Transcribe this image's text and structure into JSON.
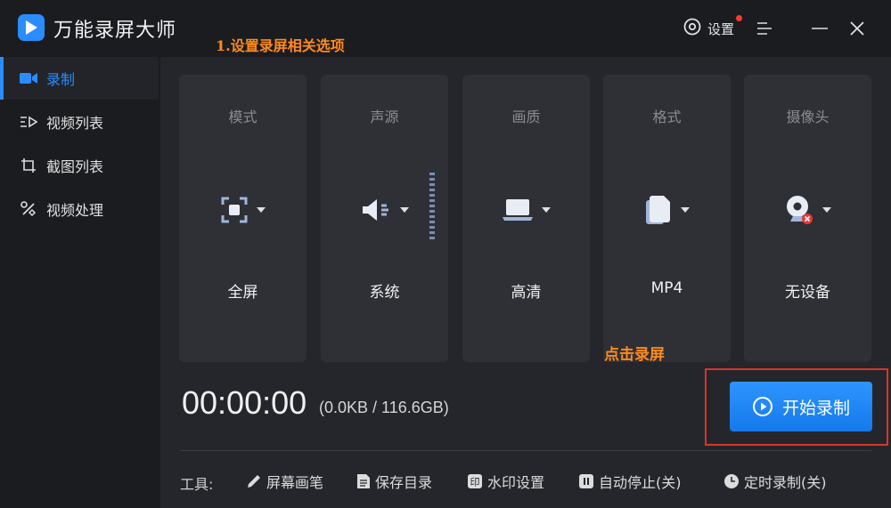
{
  "app": {
    "title": "万能录屏大师"
  },
  "annotations": {
    "step1": "1.设置录屏相关选项",
    "step2": "点击录屏"
  },
  "header": {
    "settings_label": "设置"
  },
  "sidebar": {
    "items": [
      {
        "label": "录制",
        "icon": "camera-icon"
      },
      {
        "label": "视频列表",
        "icon": "video-list-icon"
      },
      {
        "label": "截图列表",
        "icon": "screenshot-list-icon"
      },
      {
        "label": "视频处理",
        "icon": "tools-icon"
      }
    ]
  },
  "options": [
    {
      "title": "模式",
      "value": "全屏",
      "icon": "fullscreen-icon"
    },
    {
      "title": "声源",
      "value": "系统",
      "icon": "speaker-icon"
    },
    {
      "title": "画质",
      "value": "高清",
      "icon": "laptop-icon"
    },
    {
      "title": "格式",
      "value": "MP4",
      "icon": "file-icon"
    },
    {
      "title": "摄像头",
      "value": "无设备",
      "icon": "webcam-icon"
    }
  ],
  "recording": {
    "timer": "00:00:00",
    "size": "(0.0KB / 116.6GB)",
    "start_label": "开始录制"
  },
  "tools": {
    "label": "工具:",
    "items": [
      {
        "label": "屏幕画笔",
        "icon": "pen-icon"
      },
      {
        "label": "保存目录",
        "icon": "folder-icon"
      },
      {
        "label": "水印设置",
        "icon": "watermark-icon"
      },
      {
        "label": "自动停止(关)",
        "icon": "pause-icon"
      },
      {
        "label": "定时录制(关)",
        "icon": "clock-icon"
      }
    ]
  },
  "colors": {
    "accent": "#2b8cff",
    "annotation": "#ff8a1c",
    "highlight": "#d8352a"
  }
}
